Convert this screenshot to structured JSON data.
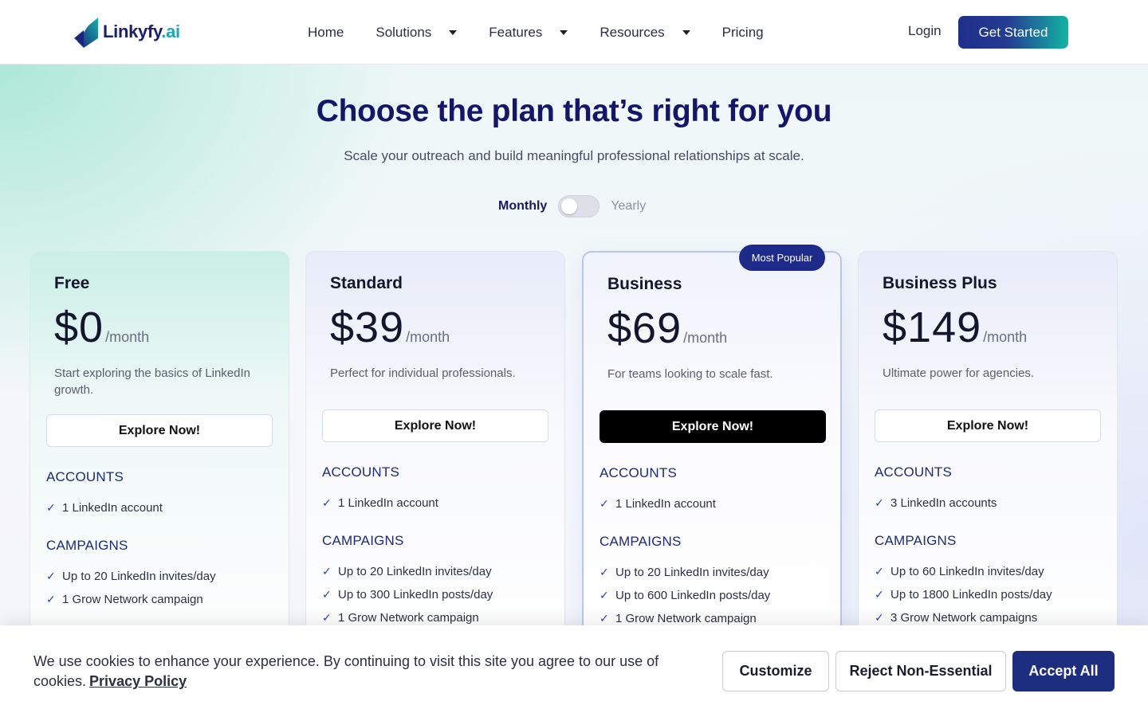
{
  "header": {
    "logo_text": "Linkyfy",
    "logo_suffix": ".ai",
    "nav": [
      "Home",
      "Solutions",
      "Features",
      "Resources",
      "Pricing"
    ],
    "login": "Login",
    "cta": "Get Started"
  },
  "hero": {
    "title": "Choose the plan that’s right for you",
    "subtitle": "Scale your outreach and build meaningful professional relationships at scale.",
    "toggle": {
      "left": "Monthly",
      "right": "Yearly",
      "selected": "Monthly"
    }
  },
  "badge": "Most Popular",
  "plans": [
    {
      "name": "Free",
      "price": "$0",
      "unit": "/month",
      "desc": "Start exploring the basics of LinkedIn growth.",
      "cta": "Explore Now!",
      "sections": [
        {
          "title": "ACCOUNTS",
          "items": [
            "1 LinkedIn account"
          ]
        },
        {
          "title": "CAMPAIGNS",
          "items": [
            "Up to 20 LinkedIn invites/day",
            "1 Grow Network campaign"
          ]
        }
      ]
    },
    {
      "name": "Standard",
      "price": "$39",
      "unit": "/month",
      "desc": "Perfect for individual professionals.",
      "cta": "Explore Now!",
      "sections": [
        {
          "title": "ACCOUNTS",
          "items": [
            "1 LinkedIn account"
          ]
        },
        {
          "title": "CAMPAIGNS",
          "items": [
            "Up to 20 LinkedIn invites/day",
            "Up to 300 LinkedIn posts/day",
            "1 Grow Network campaign"
          ]
        }
      ]
    },
    {
      "name": "Business",
      "price": "$69",
      "unit": "/month",
      "desc": "For teams looking to scale fast.",
      "cta": "Explore Now!",
      "sections": [
        {
          "title": "ACCOUNTS",
          "items": [
            "1 LinkedIn account"
          ]
        },
        {
          "title": "CAMPAIGNS",
          "items": [
            "Up to 20 LinkedIn invites/day",
            "Up to 600 LinkedIn posts/day",
            "1 Grow Network campaign"
          ]
        }
      ]
    },
    {
      "name": "Business Plus",
      "price": "$149",
      "unit": "/month",
      "desc": "Ultimate power for agencies.",
      "cta": "Explore Now!",
      "sections": [
        {
          "title": "ACCOUNTS",
          "items": [
            "3 LinkedIn accounts"
          ]
        },
        {
          "title": "CAMPAIGNS",
          "items": [
            "Up to 60 LinkedIn invites/day",
            "Up to 1800 LinkedIn posts/day",
            "3 Grow Network campaigns"
          ]
        }
      ]
    }
  ],
  "cookie": {
    "text": "We use cookies to enhance your experience. By continuing to visit this site you agree to our use of cookies.",
    "link": "Privacy Policy",
    "customize": "Customize",
    "reject": "Reject Non-Essential",
    "accept": "Accept All"
  },
  "colors": {
    "brand": "#1d2a8a",
    "accent": "#12b5a3",
    "heading": "#14166b"
  },
  "icons": {
    "check": "check-icon",
    "caret": "caret-down-icon"
  }
}
